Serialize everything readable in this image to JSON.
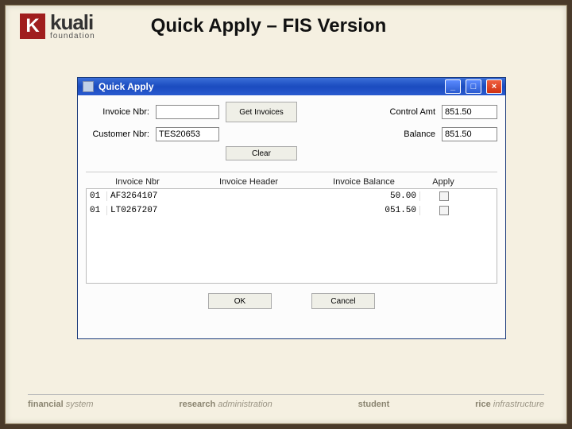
{
  "brand": {
    "name": "kuali",
    "sub": "foundation"
  },
  "slide_title": "Quick Apply – FIS Version",
  "window": {
    "title": "Quick Apply",
    "labels": {
      "invoice_nbr": "Invoice Nbr:",
      "customer_nbr": "Customer Nbr:",
      "control_amt": "Control Amt",
      "balance": "Balance"
    },
    "values": {
      "invoice_nbr": "",
      "customer_nbr": "TES20653",
      "control_amt": "851.50",
      "balance": "851.50"
    },
    "buttons": {
      "get_invoices": "Get Invoices",
      "clear": "Clear",
      "ok": "OK",
      "cancel": "Cancel"
    },
    "grid": {
      "headers": {
        "invoice_nbr": "Invoice Nbr",
        "invoice_header": "Invoice Header",
        "invoice_balance": "Invoice Balance",
        "apply": "Apply"
      },
      "rows": [
        {
          "prefix": "01",
          "invoice_nbr": "AF3264107",
          "header": "",
          "balance": "50.00"
        },
        {
          "prefix": "01",
          "invoice_nbr": "LT0267207",
          "header": "",
          "balance": "051.50"
        }
      ]
    }
  },
  "footer": {
    "c1a": "financial",
    "c1b": "system",
    "c2a": "research",
    "c2b": "administration",
    "c3a": "student",
    "c4a": "rice",
    "c4b": "infrastructure"
  }
}
